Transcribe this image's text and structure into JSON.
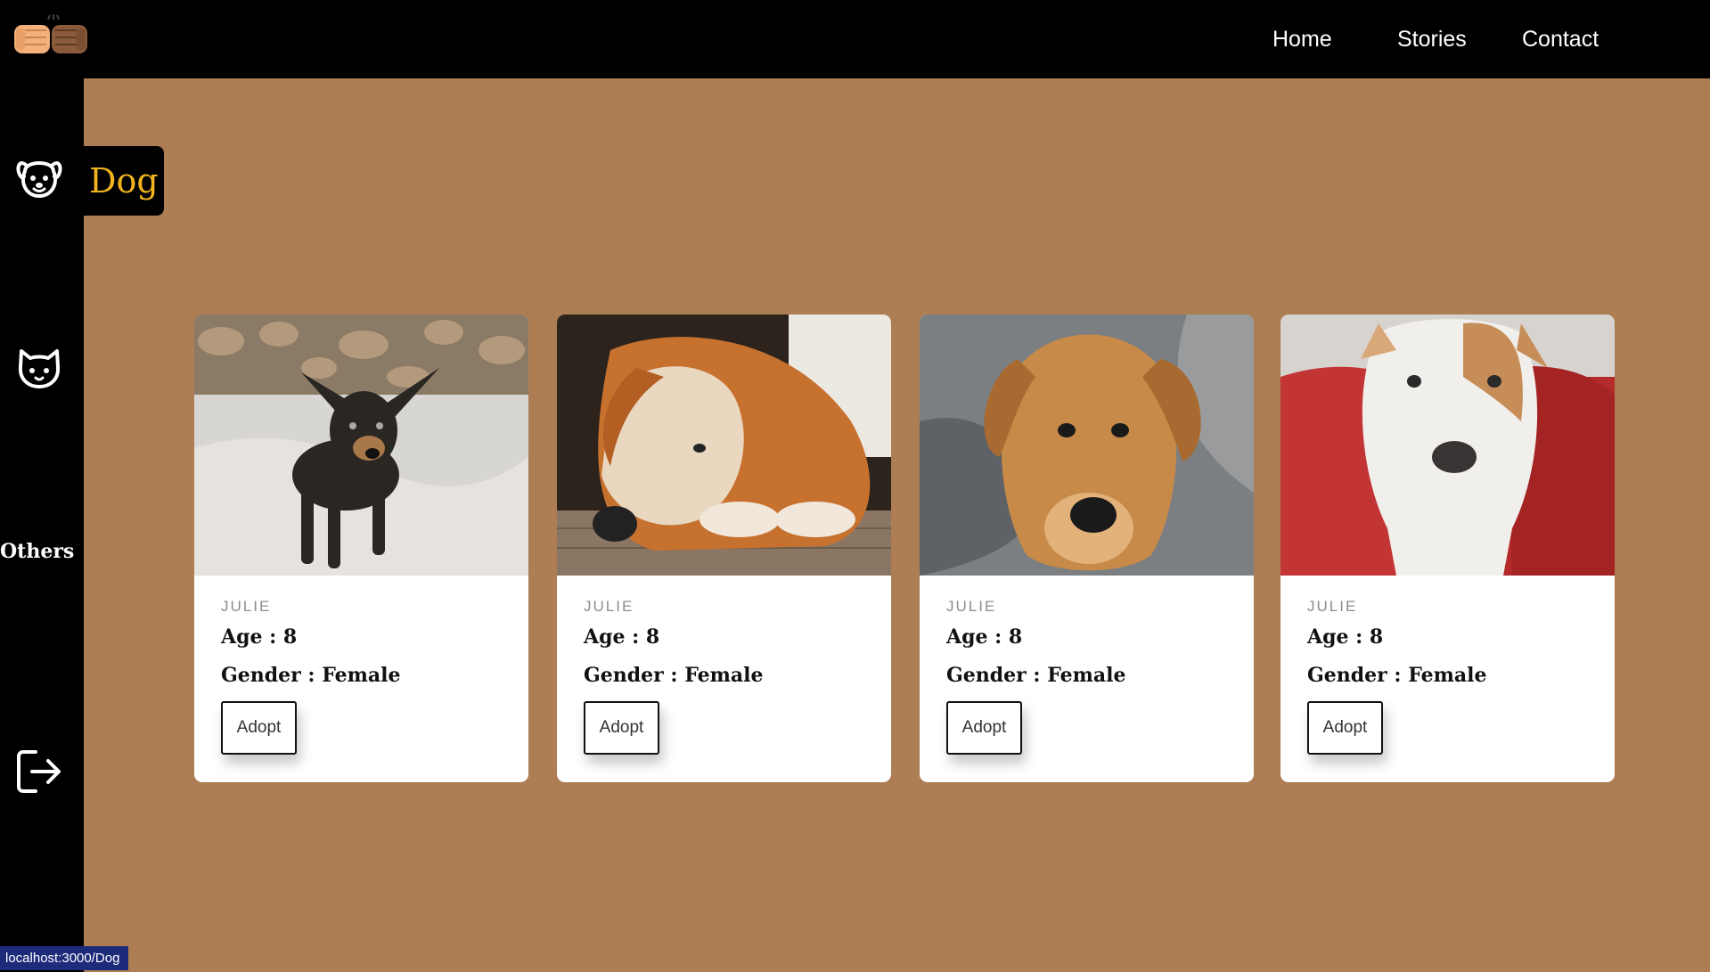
{
  "nav": {
    "home": "Home",
    "stories": "Stories",
    "contact": "Contact"
  },
  "sidebar": {
    "dog_icon": "dog-icon",
    "cat_icon": "cat-icon",
    "others_label": "Others",
    "logout_icon": "logout-icon",
    "active_tooltip": "Dog"
  },
  "cards": [
    {
      "name": "JULIE",
      "age": "Age : 8",
      "gender": "Gender : Female",
      "button": "Adopt"
    },
    {
      "name": "JULIE",
      "age": "Age : 8",
      "gender": "Gender : Female",
      "button": "Adopt"
    },
    {
      "name": "JULIE",
      "age": "Age : 8",
      "gender": "Gender : Female",
      "button": "Adopt"
    },
    {
      "name": "JULIE",
      "age": "Age : 8",
      "gender": "Gender : Female",
      "button": "Adopt"
    }
  ],
  "status_url": "localhost:3000/Dog",
  "colors": {
    "page_bg": "#ad7d53",
    "bar_bg": "#000000",
    "tooltip_text": "#f2b41d",
    "status_bg": "#1d2b7a"
  }
}
